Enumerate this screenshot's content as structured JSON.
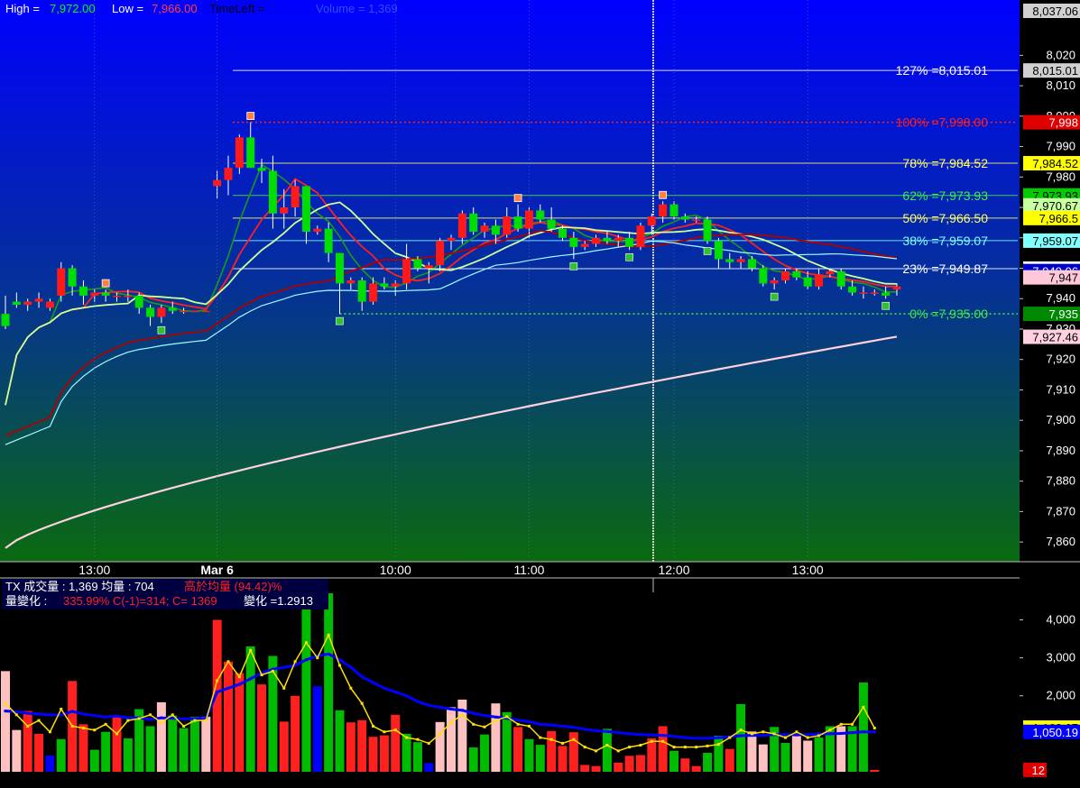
{
  "header": {
    "high_label": "High = ",
    "high_value": "7,972.00",
    "low_label": "Low = ",
    "low_value": "7,966.00",
    "timeleft_label": "TimeLeft = ",
    "volume_label": "Volume = 1,369"
  },
  "volume_header": {
    "line1_a": "TX  成交量 : 1,369  均量 : 704  ",
    "line1_b": "高於均量 (94.42)%",
    "line2_a": "量變化 : ",
    "line2_b": "335.99%   C(-1)=314; C= 1369 ",
    "line2_c": " 變化 =1.2913"
  },
  "colors": {
    "up": "#ff1a1a",
    "down": "#00dd00",
    "ma_red": "#ff2020",
    "ma_darkred": "#b00000",
    "ma_green": "#1a9a1a",
    "ma_lightgreen": "#ccff99",
    "ma_cyan": "#a0ffff",
    "ma_pink": "#ffd0e0",
    "vol_avg": "#0000ff",
    "vol_ma": "#ffe000"
  },
  "chart_data": [
    {
      "type": "candlestick",
      "ylim": [
        7855,
        8037
      ],
      "y_ticks": [
        "7,860",
        "7,870",
        "7,880",
        "7,890",
        "7,900",
        "7,910",
        "7,920",
        "7,930",
        "7,940",
        "7,950",
        "7,960",
        "7,970",
        "7,980",
        "7,990",
        "8,000",
        "8,010",
        "8,020"
      ],
      "x_ticks": [
        {
          "label": "13:00",
          "bar": 8
        },
        {
          "label": "Mar 6",
          "bar": 19
        },
        {
          "label": "10:00",
          "bar": 35
        },
        {
          "label": "11:00",
          "bar": 47
        },
        {
          "label": "12:00",
          "bar": 60
        },
        {
          "label": "13:00",
          "bar": 72
        }
      ],
      "candles": [
        [
          7935,
          7941,
          7930,
          7931
        ],
        [
          7939,
          7942,
          7937,
          7938
        ],
        [
          7938,
          7940,
          7936,
          7939
        ],
        [
          7939,
          7942,
          7937,
          7940
        ],
        [
          7937,
          7940,
          7936,
          7939
        ],
        [
          7941,
          7952,
          7939,
          7950
        ],
        [
          7950,
          7951,
          7941,
          7944
        ],
        [
          7944,
          7946,
          7938,
          7941
        ],
        [
          7941,
          7943,
          7939,
          7942
        ],
        [
          7942,
          7943,
          7939,
          7941
        ],
        [
          7941,
          7942,
          7939,
          7941
        ],
        [
          7941,
          7943,
          7939,
          7941
        ],
        [
          7941,
          7942,
          7935,
          7937
        ],
        [
          7937,
          7938,
          7931,
          7934
        ],
        [
          7934,
          7938,
          7932,
          7937
        ],
        [
          7937,
          7939,
          7935,
          7936
        ],
        [
          7936,
          7937,
          7935,
          7936
        ],
        [
          7936,
          7936,
          7936,
          7936
        ],
        [
          7936,
          7936,
          7936,
          7936
        ],
        [
          7977,
          7982,
          7973,
          7979
        ],
        [
          7979,
          7987,
          7974,
          7983
        ],
        [
          7983,
          7994,
          7981,
          7993
        ],
        [
          7993,
          7998,
          7983,
          7983
        ],
        [
          7983,
          7986,
          7978,
          7982
        ],
        [
          7982,
          7987,
          7963,
          7968
        ],
        [
          7968,
          7976,
          7963,
          7970
        ],
        [
          7970,
          7979,
          7967,
          7977
        ],
        [
          7977,
          7977,
          7958,
          7962
        ],
        [
          7962,
          7964,
          7961,
          7963
        ],
        [
          7963,
          7965,
          7952,
          7955
        ],
        [
          7955,
          7955,
          7935,
          7945
        ],
        [
          7945,
          7947,
          7943,
          7946
        ],
        [
          7946,
          7947,
          7936,
          7939
        ],
        [
          7939,
          7947,
          7938,
          7945
        ],
        [
          7945,
          7947,
          7943,
          7944
        ],
        [
          7944,
          7946,
          7941,
          7945
        ],
        [
          7945,
          7958,
          7943,
          7953
        ],
        [
          7953,
          7954,
          7949,
          7950
        ],
        [
          7950,
          7952,
          7945,
          7951
        ],
        [
          7951,
          7960,
          7949,
          7959
        ],
        [
          7959,
          7961,
          7956,
          7960
        ],
        [
          7960,
          7969,
          7958,
          7968
        ],
        [
          7968,
          7970,
          7961,
          7962
        ],
        [
          7962,
          7965,
          7960,
          7964
        ],
        [
          7964,
          7966,
          7958,
          7961
        ],
        [
          7961,
          7970,
          7960,
          7967
        ],
        [
          7967,
          7971,
          7962,
          7963
        ],
        [
          7963,
          7970,
          7960,
          7969
        ],
        [
          7969,
          7971,
          7965,
          7966
        ],
        [
          7966,
          7970,
          7962,
          7963
        ],
        [
          7963,
          7964,
          7959,
          7960
        ],
        [
          7960,
          7962,
          7953,
          7957
        ],
        [
          7957,
          7959,
          7956,
          7958
        ],
        [
          7958,
          7961,
          7957,
          7960
        ],
        [
          7960,
          7962,
          7958,
          7959
        ],
        [
          7959,
          7961,
          7957,
          7960
        ],
        [
          7960,
          7962,
          7956,
          7957
        ],
        [
          7957,
          7965,
          7956,
          7964
        ],
        [
          7964,
          7968,
          7961,
          7967
        ],
        [
          7967,
          7972,
          7965,
          7971
        ],
        [
          7971,
          7972,
          7966,
          7967
        ],
        [
          7967,
          7968,
          7965,
          7966
        ],
        [
          7966,
          7967,
          7965,
          7966
        ],
        [
          7966,
          7967,
          7958,
          7959
        ],
        [
          7959,
          7960,
          7950,
          7953
        ],
        [
          7953,
          7955,
          7950,
          7952
        ],
        [
          7952,
          7954,
          7950,
          7953
        ],
        [
          7953,
          7954,
          7949,
          7950
        ],
        [
          7950,
          7951,
          7944,
          7945
        ],
        [
          7945,
          7947,
          7943,
          7946
        ],
        [
          7946,
          7950,
          7945,
          7949
        ],
        [
          7949,
          7950,
          7946,
          7947
        ],
        [
          7947,
          7949,
          7943,
          7944
        ],
        [
          7944,
          7950,
          7943,
          7948
        ],
        [
          7948,
          7950,
          7947,
          7949
        ],
        [
          7949,
          7950,
          7943,
          7944
        ],
        [
          7944,
          7946,
          7941,
          7942
        ],
        [
          7942,
          7944,
          7940,
          7942
        ],
        [
          7942,
          7943,
          7941,
          7942
        ],
        [
          7942,
          7944,
          7940,
          7941
        ],
        [
          7943,
          7945,
          7941,
          7944
        ]
      ],
      "fib_levels": [
        {
          "label": "127% =8,015.01",
          "value": 8015.01,
          "color": "#ffffff"
        },
        {
          "label": "100% =7,998.00",
          "value": 7998.0,
          "color": "#ff2020"
        },
        {
          "label": "78% =7,984.52",
          "value": 7984.52,
          "color": "#ffff60"
        },
        {
          "label": "62% =7,973.93",
          "value": 7973.93,
          "color": "#40ee40"
        },
        {
          "label": "50% =7,966.50",
          "value": 7966.5,
          "color": "#ffff60"
        },
        {
          "label": "38% =7,959.07",
          "value": 7959.07,
          "color": "#80ffff"
        },
        {
          "label": "23% =7,949.87",
          "value": 7949.87,
          "color": "#ffffff"
        },
        {
          "label": "0% =7,935.00",
          "value": 7935.0,
          "color": "#40ee40"
        }
      ],
      "price_tags": [
        {
          "label": "8,037.06",
          "value": 8036.5,
          "bg": "#d0d0d0",
          "fg": "#000000"
        },
        {
          "label": "8,015.01",
          "value": 8015.01,
          "bg": "#d0d0d0",
          "fg": "#000000"
        },
        {
          "label": "7,998",
          "value": 7998,
          "bg": "#e00000",
          "fg": "#ffffff"
        },
        {
          "label": "7,984.52",
          "value": 7984.52,
          "bg": "#ffff00",
          "fg": "#000000"
        },
        {
          "label": "7,973.93",
          "value": 7973.93,
          "bg": "#00cc00",
          "fg": "#000000"
        },
        {
          "label": "7,970.67",
          "value": 7970.67,
          "bg": "#c8ffa0",
          "fg": "#000000"
        },
        {
          "label": "7,966.5",
          "value": 7966.5,
          "bg": "#ffff00",
          "fg": "#000000"
        },
        {
          "label": "7,959.07",
          "value": 7959.07,
          "bg": "#80ffff",
          "fg": "#000000"
        },
        {
          "label": "7,949.87",
          "value": 7949.87,
          "bg": "#ffffff",
          "fg": "#000000"
        },
        {
          "label": "7,949.06",
          "value": 7949.06,
          "bg": "#0000cc",
          "fg": "#ffffff"
        },
        {
          "label": "7,947",
          "value": 7947,
          "bg": "#ffc8d8",
          "fg": "#000000"
        },
        {
          "label": "7,935",
          "value": 7935,
          "bg": "#008800",
          "fg": "#ffffff"
        },
        {
          "label": "7,927.46",
          "value": 7927.46,
          "bg": "#ffd0e0",
          "fg": "#000000"
        }
      ],
      "markers_K": [
        9,
        22,
        46,
        59
      ],
      "markers_Z": [
        14,
        30,
        51,
        56,
        63,
        69,
        79
      ]
    },
    {
      "type": "bar",
      "ylim": [
        0,
        4700
      ],
      "y_ticks": [
        "2,000",
        "3,000",
        "4,000"
      ],
      "vol_colors": [
        "#ffc0c0",
        "#ff2020",
        "#00bb00",
        "#0000ff"
      ],
      "volumes": [
        [
          2650,
          0
        ],
        [
          1100,
          0
        ],
        [
          1600,
          1
        ],
        [
          1000,
          1
        ],
        [
          430,
          3
        ],
        [
          860,
          2
        ],
        [
          2390,
          1
        ],
        [
          1250,
          1
        ],
        [
          580,
          2
        ],
        [
          1050,
          2
        ],
        [
          1450,
          1
        ],
        [
          880,
          2
        ],
        [
          1650,
          2
        ],
        [
          1200,
          2
        ],
        [
          1830,
          0
        ],
        [
          1480,
          2
        ],
        [
          1150,
          2
        ],
        [
          1450,
          2
        ],
        [
          1450,
          0
        ],
        [
          4000,
          1
        ],
        [
          2900,
          1
        ],
        [
          2600,
          1
        ],
        [
          3300,
          2
        ],
        [
          2300,
          1
        ],
        [
          3050,
          2
        ],
        [
          1320,
          1
        ],
        [
          2000,
          1
        ],
        [
          4300,
          2
        ],
        [
          2250,
          3
        ],
        [
          4700,
          2
        ],
        [
          1620,
          2
        ],
        [
          1300,
          1
        ],
        [
          1360,
          1
        ],
        [
          920,
          1
        ],
        [
          960,
          1
        ],
        [
          1500,
          1
        ],
        [
          1000,
          2
        ],
        [
          780,
          2
        ],
        [
          230,
          3
        ],
        [
          1310,
          0
        ],
        [
          1700,
          0
        ],
        [
          1900,
          0
        ],
        [
          640,
          2
        ],
        [
          980,
          2
        ],
        [
          1800,
          0
        ],
        [
          1570,
          2
        ],
        [
          1180,
          1
        ],
        [
          860,
          2
        ],
        [
          710,
          2
        ],
        [
          1070,
          1
        ],
        [
          680,
          1
        ],
        [
          1040,
          1
        ],
        [
          180,
          1
        ],
        [
          150,
          1
        ],
        [
          1130,
          2
        ],
        [
          240,
          1
        ],
        [
          420,
          1
        ],
        [
          440,
          1
        ],
        [
          880,
          1
        ],
        [
          1200,
          1
        ],
        [
          550,
          2
        ],
        [
          350,
          1
        ],
        [
          150,
          1
        ],
        [
          500,
          2
        ],
        [
          950,
          2
        ],
        [
          600,
          1
        ],
        [
          1780,
          2
        ],
        [
          1060,
          0
        ],
        [
          720,
          0
        ],
        [
          1180,
          2
        ],
        [
          760,
          2
        ],
        [
          1000,
          0
        ],
        [
          820,
          0
        ],
        [
          900,
          2
        ],
        [
          1200,
          2
        ],
        [
          1200,
          0
        ],
        [
          1200,
          2
        ],
        [
          2350,
          2
        ],
        [
          50,
          1
        ]
      ],
      "avg_line": [
        1600,
        1580,
        1540,
        1520,
        1500,
        1490,
        1590,
        1520,
        1480,
        1440,
        1470,
        1420,
        1420,
        1380,
        1420,
        1410,
        1390,
        1400,
        1410,
        2100,
        2200,
        2300,
        2450,
        2600,
        2700,
        2750,
        2800,
        2950,
        3050,
        3100,
        2950,
        2750,
        2500,
        2350,
        2200,
        2100,
        2000,
        1850,
        1750,
        1700,
        1650,
        1620,
        1540,
        1480,
        1440,
        1410,
        1360,
        1320,
        1250,
        1230,
        1200,
        1170,
        1120,
        1080,
        1060,
        1030,
        1000,
        980,
        970,
        960,
        930,
        900,
        880,
        880,
        900,
        920,
        950,
        960,
        960,
        980,
        980,
        970,
        980,
        990,
        1000,
        1010,
        1030,
        1050,
        1050
      ],
      "ma_line": [
        1800,
        1500,
        1200,
        1350,
        1050,
        1650,
        1200,
        1150,
        1100,
        1250,
        1000,
        1350,
        1400,
        1500,
        1300,
        1500,
        1200,
        1350,
        1350,
        2400,
        2900,
        2500,
        3200,
        2550,
        2650,
        2200,
        2900,
        3400,
        3000,
        3600,
        2800,
        2200,
        1800,
        1200,
        1050,
        1100,
        900,
        850,
        750,
        1000,
        1300,
        1500,
        1250,
        1180,
        1350,
        1450,
        1250,
        1200,
        900,
        850,
        750,
        850,
        650,
        550,
        700,
        550,
        650,
        700,
        800,
        800,
        650,
        650,
        650,
        680,
        720,
        900,
        1100,
        1000,
        1050,
        1000,
        900,
        1050,
        900,
        950,
        1100,
        1250,
        1250,
        1700,
        1150
      ]
    }
  ]
}
